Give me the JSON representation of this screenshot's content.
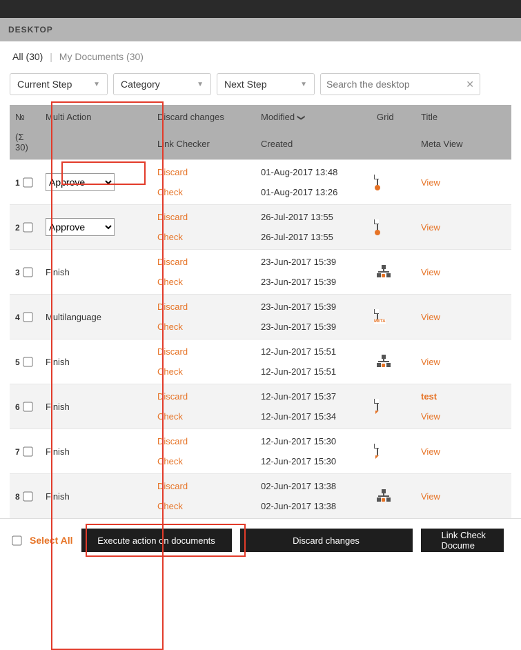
{
  "desktop_label": "DESKTOP",
  "tabs": {
    "all": "All (30)",
    "my": "My Documents (30)"
  },
  "filters": {
    "current_step": "Current Step",
    "category": "Category",
    "next_step": "Next Step",
    "search_placeholder": "Search the desktop"
  },
  "headers": {
    "num": "№",
    "sigma": "(Σ 30)",
    "multi_action": "Multi Action",
    "discard_changes": "Discard changes",
    "link_checker": "Link Checker",
    "modified": "Modified",
    "created": "Created",
    "grid": "Grid",
    "title": "Title",
    "meta_view": "Meta View"
  },
  "labels": {
    "discard": "Discard",
    "check": "Check",
    "view": "View",
    "approve_option": "Approve"
  },
  "rows": [
    {
      "n": "1",
      "action_type": "select",
      "modified": "01-Aug-2017 13:48",
      "created": "01-Aug-2017 13:26",
      "icon": "doc-dot",
      "title": "",
      "alt": false
    },
    {
      "n": "2",
      "action_type": "select",
      "modified": "26-Jul-2017 13:55",
      "created": "26-Jul-2017 13:55",
      "icon": "doc-dot",
      "title": "",
      "alt": true
    },
    {
      "n": "3",
      "action_type": "text",
      "action_text": "Finish",
      "modified": "23-Jun-2017 15:39",
      "created": "23-Jun-2017 15:39",
      "icon": "sitemap",
      "title": "",
      "alt": false
    },
    {
      "n": "4",
      "action_type": "text",
      "action_text": "Multilanguage",
      "modified": "23-Jun-2017 15:39",
      "created": "23-Jun-2017 15:39",
      "icon": "doc-meta",
      "title": "",
      "alt": true
    },
    {
      "n": "5",
      "action_type": "text",
      "action_text": "Finish",
      "modified": "12-Jun-2017 15:51",
      "created": "12-Jun-2017 15:51",
      "icon": "sitemap",
      "title": "",
      "alt": false
    },
    {
      "n": "6",
      "action_type": "text",
      "action_text": "Finish",
      "modified": "12-Jun-2017 15:37",
      "created": "12-Jun-2017 15:34",
      "icon": "doc-arrow",
      "title": "test",
      "alt": true
    },
    {
      "n": "7",
      "action_type": "text",
      "action_text": "Finish",
      "modified": "12-Jun-2017 15:30",
      "created": "12-Jun-2017 15:30",
      "icon": "doc-arrow",
      "title": "",
      "alt": false
    },
    {
      "n": "8",
      "action_type": "text",
      "action_text": "Finish",
      "modified": "02-Jun-2017 13:38",
      "created": "02-Jun-2017 13:38",
      "icon": "sitemap",
      "title": "",
      "alt": true
    }
  ],
  "partial_row": {
    "discard": "Discard",
    "modified": "02-Jun-2017 13:38"
  },
  "footer": {
    "select_all": "Select All",
    "execute": "Execute action on documents",
    "discard": "Discard changes",
    "linkcheck": "Link Check Docume"
  }
}
